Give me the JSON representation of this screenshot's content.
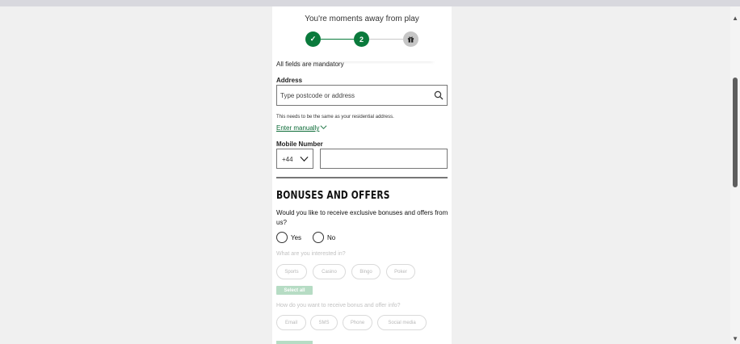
{
  "stepper": {
    "heading": "You're moments away from play",
    "step1_glyph": "✓",
    "step2_number": "2",
    "step3_icon": "gift-icon"
  },
  "form": {
    "mandatory_note": "All fields are mandatory",
    "address": {
      "label": "Address",
      "placeholder": "Type postcode or address",
      "hint": "This needs to be the same as your residential address.",
      "enter_manually": "Enter manually"
    },
    "mobile": {
      "label": "Mobile Number",
      "country_code": "+44",
      "value": ""
    }
  },
  "bonuses": {
    "title": "BONUSES AND OFFERS",
    "question": "Would you like to receive exclusive bonuses and offers from us?",
    "options": {
      "yes": "Yes",
      "no": "No"
    },
    "interests_label": "What are you interested in?",
    "interests": [
      "Sports",
      "Casino",
      "Bingo",
      "Poker"
    ],
    "select_all": "Select all",
    "channels_label": "How do you want to receive bonus and offer info?",
    "channels": [
      "Email",
      "SMS",
      "Phone",
      "Social media"
    ]
  },
  "colors": {
    "brand_green": "#0a7a3c",
    "disabled_green": "#b6dcc4"
  }
}
